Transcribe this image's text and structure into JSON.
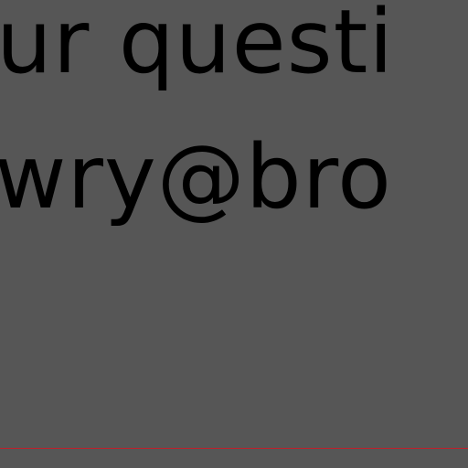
{
  "content": {
    "line_1": "ur questi",
    "line_2": "wry@bro"
  },
  "colors": {
    "background": "#565656",
    "text": "#000000",
    "rule": "#c0202a"
  }
}
